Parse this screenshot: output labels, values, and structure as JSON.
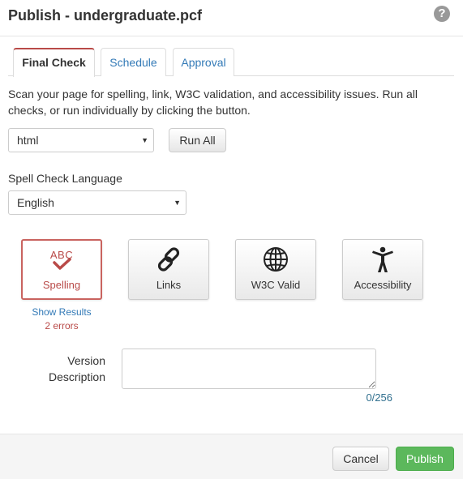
{
  "dialog": {
    "title": "Publish - undergraduate.pcf",
    "help_symbol": "?"
  },
  "tabs": [
    {
      "label": "Final Check",
      "active": true
    },
    {
      "label": "Schedule",
      "active": false
    },
    {
      "label": "Approval",
      "active": false
    }
  ],
  "final_check": {
    "description": "Scan your page for spelling, link, W3C validation, and accessibility issues. Run all checks, or run individually by clicking the button.",
    "doc_type_select": {
      "value": "html"
    },
    "run_all_label": "Run All",
    "spell_lang_label": "Spell Check Language",
    "spell_lang_select": {
      "value": "English"
    },
    "checks": [
      {
        "label": "Spelling",
        "icon": "spelling-abc-check-icon",
        "selected": true
      },
      {
        "label": "Links",
        "icon": "chain-link-icon",
        "selected": false
      },
      {
        "label": "W3C Valid",
        "icon": "globe-icon",
        "selected": false
      },
      {
        "label": "Accessibility",
        "icon": "accessibility-person-icon",
        "selected": false
      }
    ],
    "spelling_result": {
      "show_results_label": "Show Results",
      "errors_label": "2 errors"
    },
    "version_description": {
      "label_line1": "Version",
      "label_line2": "Description",
      "value": "",
      "counter": "0/256"
    }
  },
  "footer": {
    "cancel_label": "Cancel",
    "publish_label": "Publish"
  },
  "colors": {
    "link": "#337ab7",
    "active_tab_accent": "#b94a48",
    "error": "#b94a48",
    "publish_button": "#5cb85c",
    "counter": "#31708f"
  }
}
